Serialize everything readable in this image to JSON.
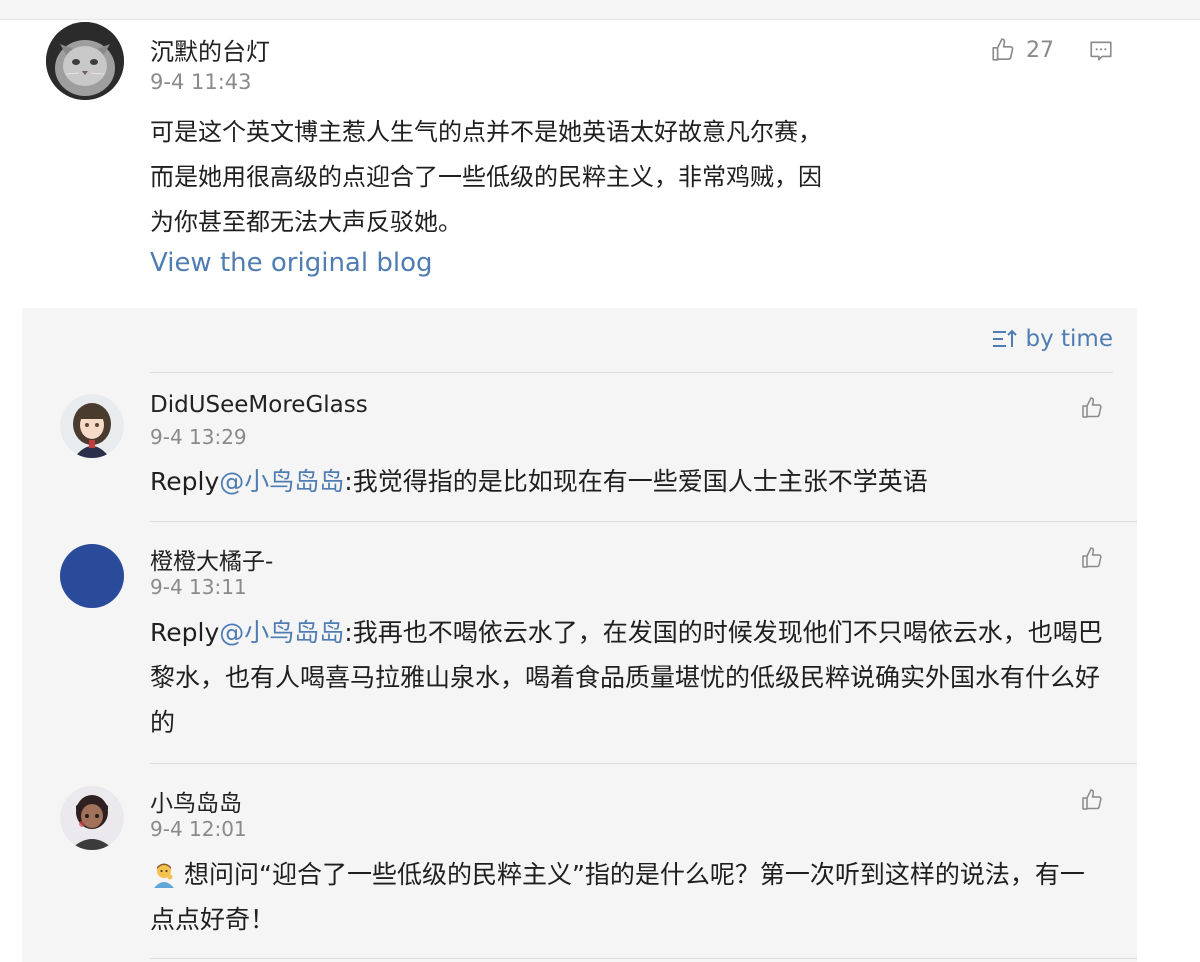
{
  "main_comment": {
    "author": "沉默的台灯",
    "time": "9-4 11:43",
    "like_count": "27",
    "text": "可是这个英文博主惹人生气的点并不是她英语太好故意凡尔赛，而是她用很高级的点迎合了一些低级的民粹主义，非常鸡贼，因为你甚至都无法大声反驳她。",
    "view_original_label": "View the original blog"
  },
  "sort": {
    "label": "by time"
  },
  "replies": [
    {
      "author": "DidUSeeMoreGlass",
      "time": "9-4 13:29",
      "prefix": "Reply",
      "mention": "@小鸟岛岛",
      "text": ":我觉得指的是比如现在有一些爱国人士主张不学英语"
    },
    {
      "author": "橙橙大橘子-",
      "time": "9-4 13:11",
      "prefix": "Reply",
      "mention": "@小鸟岛岛",
      "text": ":我再也不喝依云水了，在发国的时候发现他们不只喝依云水，也喝巴黎水，也有人喝喜马拉雅山泉水，喝着食品质量堪忧的低级民粹说确实外国水有什么好的"
    },
    {
      "author": "小鸟岛岛",
      "time": "9-4 12:01",
      "text": "想问问“迎合了一些低级的民粹主义”指的是什么呢？第一次听到这样的说法，有一点点好奇！"
    }
  ],
  "colors": {
    "link": "#4f7db3",
    "muted": "#8a8a8a",
    "panel_bg": "#f5f5f5",
    "avatar_blue": "#2a4a9a"
  },
  "icons": {
    "like": "thumbs-up-icon",
    "reply": "comment-icon",
    "sort": "sort-icon",
    "emoji": "thinking-person-emoji"
  }
}
